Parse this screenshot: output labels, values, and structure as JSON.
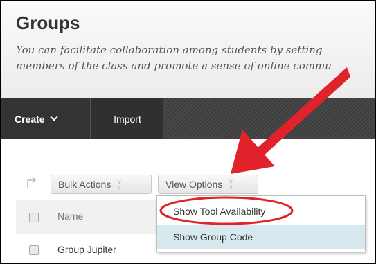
{
  "page": {
    "title": "Groups",
    "description_line1": "You can facilitate collaboration among students by setting",
    "description_line2": "members of the class and promote a sense of online commu"
  },
  "toolbar": {
    "create_label": "Create",
    "import_label": "Import"
  },
  "actions": {
    "bulk_label": "Bulk Actions",
    "view_options_label": "View Options"
  },
  "grid": {
    "header_name": "Name",
    "rows": [
      {
        "name": "Group Jupiter"
      }
    ]
  },
  "view_options_menu": {
    "items": [
      {
        "label": "Show Tool Availability"
      },
      {
        "label": "Show Group Code"
      }
    ]
  },
  "colors": {
    "annotation_red": "#e0232a",
    "highlight_row": "#d7e9ef",
    "toolbar_dark": "#333333"
  }
}
